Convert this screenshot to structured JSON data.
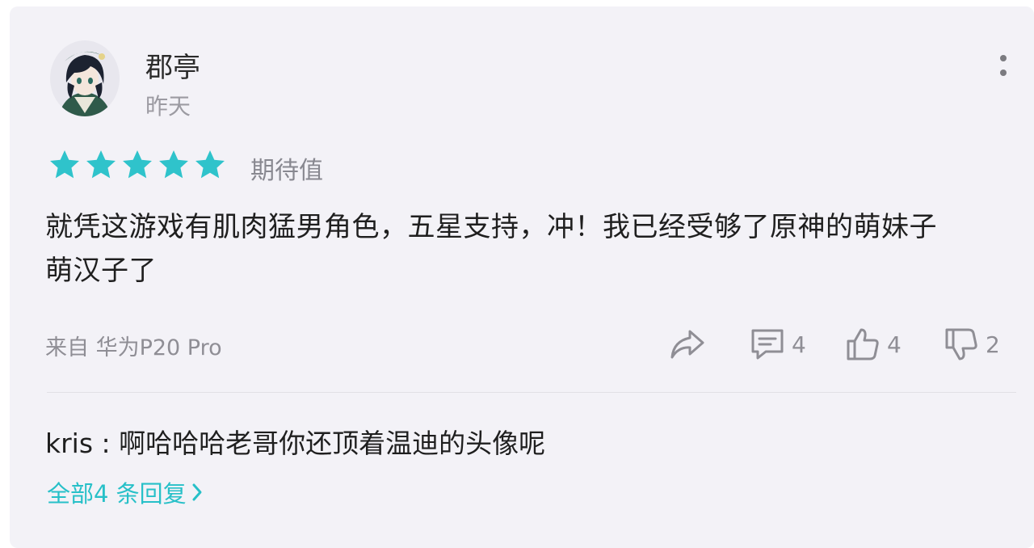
{
  "comment": {
    "user": {
      "name": "郡亭",
      "time": "昨天"
    },
    "rating": {
      "stars": 5,
      "max_stars": 5,
      "label": "期待值",
      "star_color": "#2fc3cb"
    },
    "text_line1": "就凭这游戏有肌肉猛男角色，五星支持，冲！我已经受够了原神的萌妹子",
    "text_line2": "萌汉子了",
    "device": "来自 华为P20 Pro",
    "actions": {
      "share_icon": "share-icon",
      "comments_count": "4",
      "likes_count": "4",
      "dislikes_count": "2"
    }
  },
  "reply": {
    "author": "kris",
    "separator": " : ",
    "text": "啊哈哈哈老哥你还顶着温迪的头像呢"
  },
  "all_replies_link": "全部4 条回复",
  "colors": {
    "accent": "#27c0c8",
    "card_bg": "#f3f2f7",
    "muted_text": "#8f8e95"
  }
}
